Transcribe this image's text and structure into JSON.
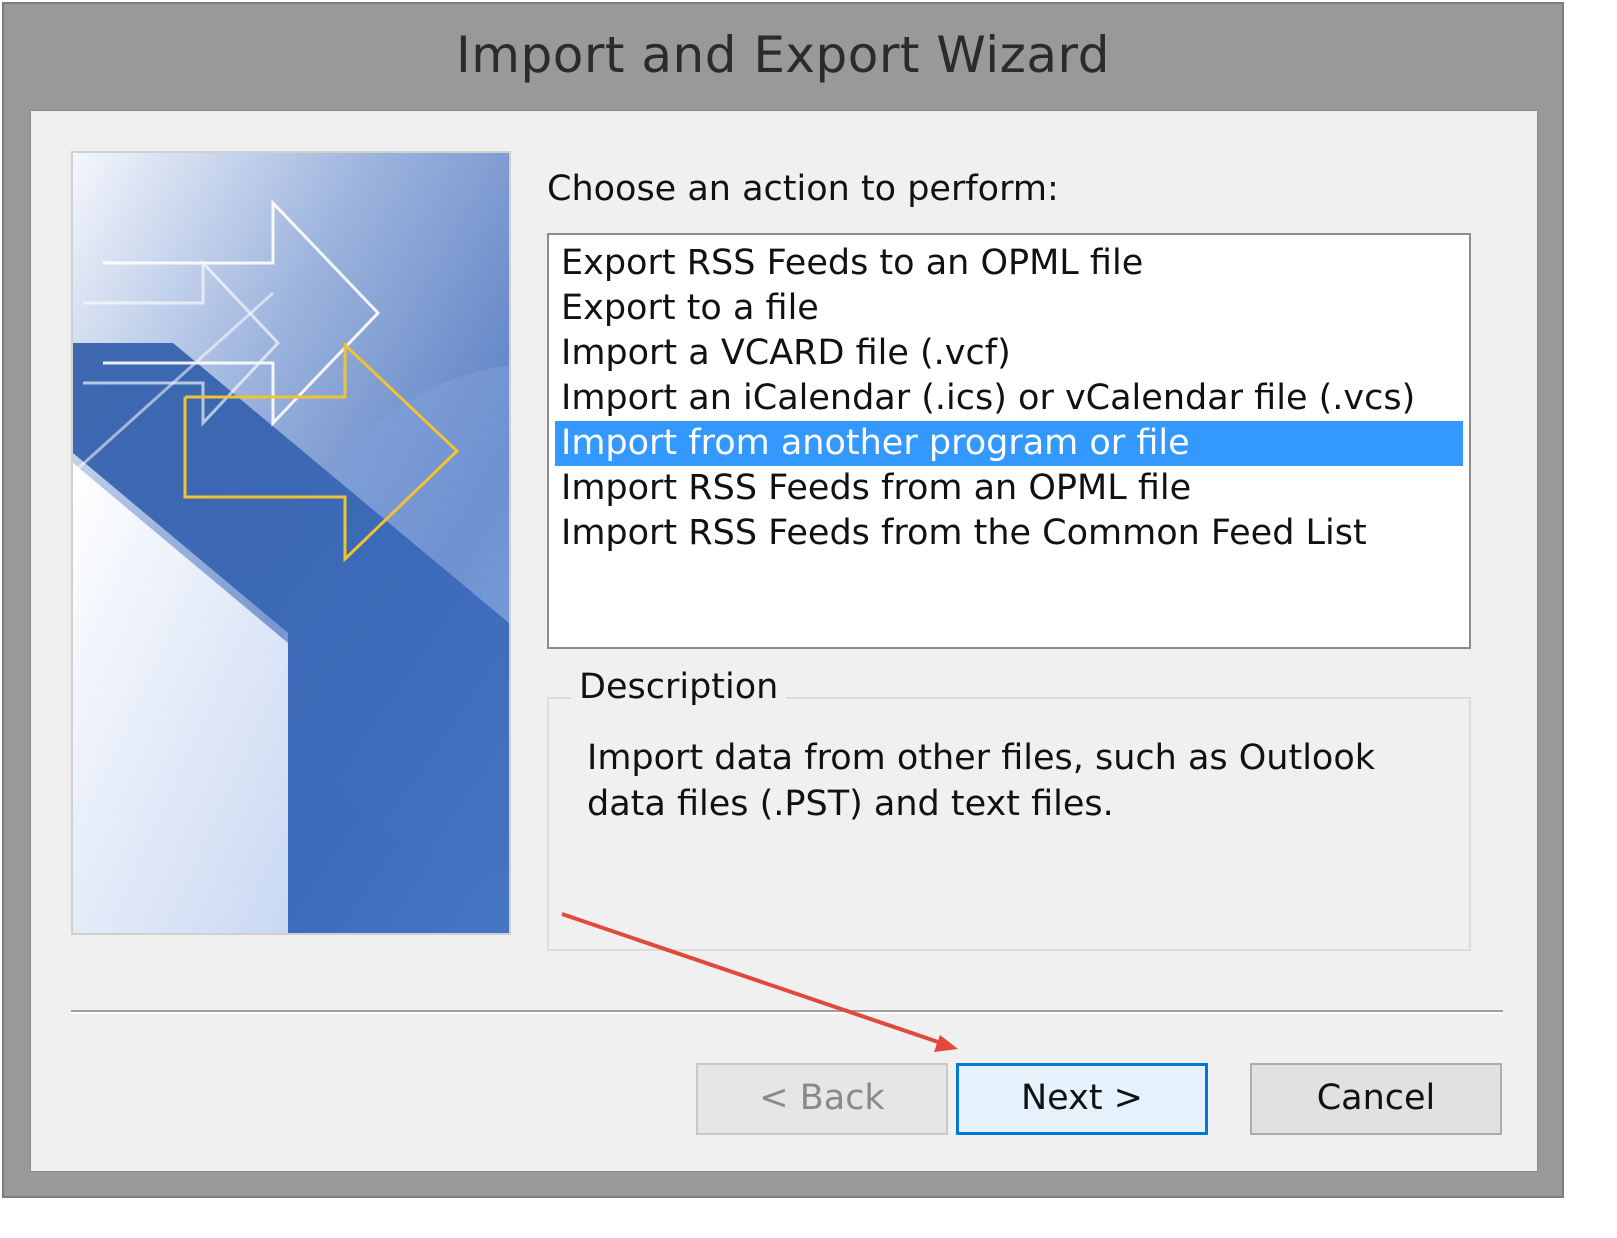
{
  "window": {
    "title": "Import and Export Wizard"
  },
  "prompt": "Choose an action to perform:",
  "actions": [
    "Export RSS Feeds to an OPML file",
    "Export to a file",
    "Import a VCARD file (.vcf)",
    "Import an iCalendar (.ics) or vCalendar file (.vcs)",
    "Import from another program or file",
    "Import RSS Feeds from an OPML file",
    "Import RSS Feeds from the Common Feed List"
  ],
  "selected_action": "Import from another program or file",
  "description": {
    "legend": "Description",
    "text": "Import data from other files, such as Outlook data files (.PST) and text files."
  },
  "buttons": {
    "back": "< Back",
    "next": "Next >",
    "cancel": "Cancel"
  },
  "colors": {
    "selection": "#3399ff",
    "annotation_arrow": "#e04a3a",
    "default_button_border": "#0078d7"
  }
}
